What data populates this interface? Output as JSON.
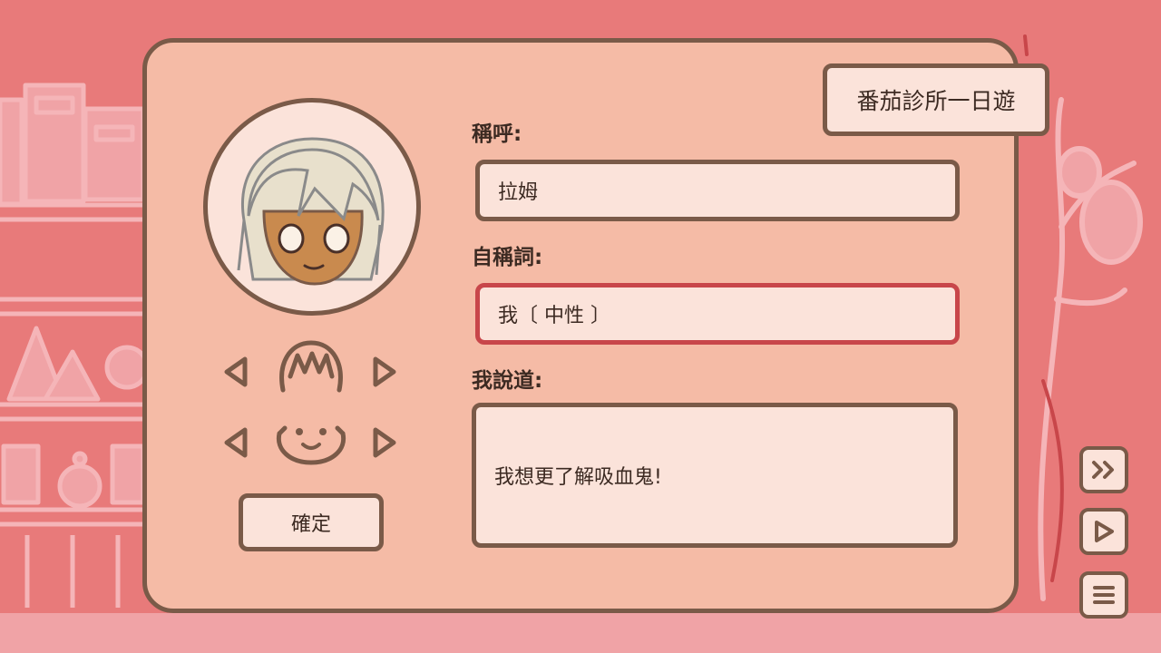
{
  "game_title": "番茄診所一日遊",
  "form": {
    "name_label": "稱呼:",
    "name_value": "拉姆",
    "pronoun_label": "自稱詞:",
    "pronoun_value": "我〔 中性 〕",
    "speech_label": "我說道:",
    "speech_value": "我想更了解吸血鬼!"
  },
  "customize": {
    "confirm_label": "確定"
  },
  "side_controls": [
    "fast-forward-icon",
    "play-icon",
    "menu-icon"
  ],
  "icons": {
    "prev": "triangle-left-icon",
    "next": "triangle-right-icon",
    "hair": "hair-icon",
    "face": "face-icon"
  },
  "colors": {
    "background": "#e87a7a",
    "panel": "#f5bba6",
    "field": "#fbe3da",
    "outline": "#7a5a48",
    "selected_outline": "#c8464a"
  }
}
